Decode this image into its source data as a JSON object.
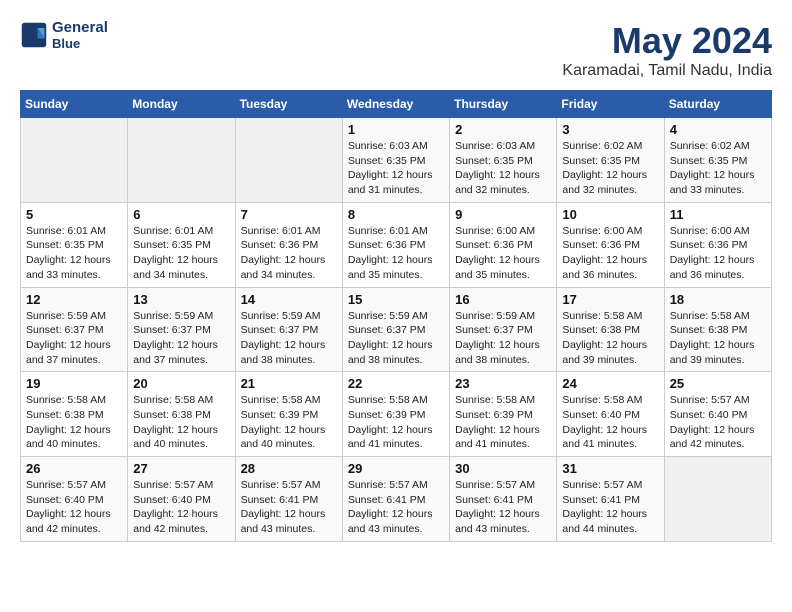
{
  "logo": {
    "line1": "General",
    "line2": "Blue"
  },
  "title": "May 2024",
  "subtitle": "Karamadai, Tamil Nadu, India",
  "weekdays": [
    "Sunday",
    "Monday",
    "Tuesday",
    "Wednesday",
    "Thursday",
    "Friday",
    "Saturday"
  ],
  "weeks": [
    [
      {
        "day": "",
        "info": ""
      },
      {
        "day": "",
        "info": ""
      },
      {
        "day": "",
        "info": ""
      },
      {
        "day": "1",
        "info": "Sunrise: 6:03 AM\nSunset: 6:35 PM\nDaylight: 12 hours\nand 31 minutes."
      },
      {
        "day": "2",
        "info": "Sunrise: 6:03 AM\nSunset: 6:35 PM\nDaylight: 12 hours\nand 32 minutes."
      },
      {
        "day": "3",
        "info": "Sunrise: 6:02 AM\nSunset: 6:35 PM\nDaylight: 12 hours\nand 32 minutes."
      },
      {
        "day": "4",
        "info": "Sunrise: 6:02 AM\nSunset: 6:35 PM\nDaylight: 12 hours\nand 33 minutes."
      }
    ],
    [
      {
        "day": "5",
        "info": "Sunrise: 6:01 AM\nSunset: 6:35 PM\nDaylight: 12 hours\nand 33 minutes."
      },
      {
        "day": "6",
        "info": "Sunrise: 6:01 AM\nSunset: 6:35 PM\nDaylight: 12 hours\nand 34 minutes."
      },
      {
        "day": "7",
        "info": "Sunrise: 6:01 AM\nSunset: 6:36 PM\nDaylight: 12 hours\nand 34 minutes."
      },
      {
        "day": "8",
        "info": "Sunrise: 6:01 AM\nSunset: 6:36 PM\nDaylight: 12 hours\nand 35 minutes."
      },
      {
        "day": "9",
        "info": "Sunrise: 6:00 AM\nSunset: 6:36 PM\nDaylight: 12 hours\nand 35 minutes."
      },
      {
        "day": "10",
        "info": "Sunrise: 6:00 AM\nSunset: 6:36 PM\nDaylight: 12 hours\nand 36 minutes."
      },
      {
        "day": "11",
        "info": "Sunrise: 6:00 AM\nSunset: 6:36 PM\nDaylight: 12 hours\nand 36 minutes."
      }
    ],
    [
      {
        "day": "12",
        "info": "Sunrise: 5:59 AM\nSunset: 6:37 PM\nDaylight: 12 hours\nand 37 minutes."
      },
      {
        "day": "13",
        "info": "Sunrise: 5:59 AM\nSunset: 6:37 PM\nDaylight: 12 hours\nand 37 minutes."
      },
      {
        "day": "14",
        "info": "Sunrise: 5:59 AM\nSunset: 6:37 PM\nDaylight: 12 hours\nand 38 minutes."
      },
      {
        "day": "15",
        "info": "Sunrise: 5:59 AM\nSunset: 6:37 PM\nDaylight: 12 hours\nand 38 minutes."
      },
      {
        "day": "16",
        "info": "Sunrise: 5:59 AM\nSunset: 6:37 PM\nDaylight: 12 hours\nand 38 minutes."
      },
      {
        "day": "17",
        "info": "Sunrise: 5:58 AM\nSunset: 6:38 PM\nDaylight: 12 hours\nand 39 minutes."
      },
      {
        "day": "18",
        "info": "Sunrise: 5:58 AM\nSunset: 6:38 PM\nDaylight: 12 hours\nand 39 minutes."
      }
    ],
    [
      {
        "day": "19",
        "info": "Sunrise: 5:58 AM\nSunset: 6:38 PM\nDaylight: 12 hours\nand 40 minutes."
      },
      {
        "day": "20",
        "info": "Sunrise: 5:58 AM\nSunset: 6:38 PM\nDaylight: 12 hours\nand 40 minutes."
      },
      {
        "day": "21",
        "info": "Sunrise: 5:58 AM\nSunset: 6:39 PM\nDaylight: 12 hours\nand 40 minutes."
      },
      {
        "day": "22",
        "info": "Sunrise: 5:58 AM\nSunset: 6:39 PM\nDaylight: 12 hours\nand 41 minutes."
      },
      {
        "day": "23",
        "info": "Sunrise: 5:58 AM\nSunset: 6:39 PM\nDaylight: 12 hours\nand 41 minutes."
      },
      {
        "day": "24",
        "info": "Sunrise: 5:58 AM\nSunset: 6:40 PM\nDaylight: 12 hours\nand 41 minutes."
      },
      {
        "day": "25",
        "info": "Sunrise: 5:57 AM\nSunset: 6:40 PM\nDaylight: 12 hours\nand 42 minutes."
      }
    ],
    [
      {
        "day": "26",
        "info": "Sunrise: 5:57 AM\nSunset: 6:40 PM\nDaylight: 12 hours\nand 42 minutes."
      },
      {
        "day": "27",
        "info": "Sunrise: 5:57 AM\nSunset: 6:40 PM\nDaylight: 12 hours\nand 42 minutes."
      },
      {
        "day": "28",
        "info": "Sunrise: 5:57 AM\nSunset: 6:41 PM\nDaylight: 12 hours\nand 43 minutes."
      },
      {
        "day": "29",
        "info": "Sunrise: 5:57 AM\nSunset: 6:41 PM\nDaylight: 12 hours\nand 43 minutes."
      },
      {
        "day": "30",
        "info": "Sunrise: 5:57 AM\nSunset: 6:41 PM\nDaylight: 12 hours\nand 43 minutes."
      },
      {
        "day": "31",
        "info": "Sunrise: 5:57 AM\nSunset: 6:41 PM\nDaylight: 12 hours\nand 44 minutes."
      },
      {
        "day": "",
        "info": ""
      }
    ]
  ]
}
